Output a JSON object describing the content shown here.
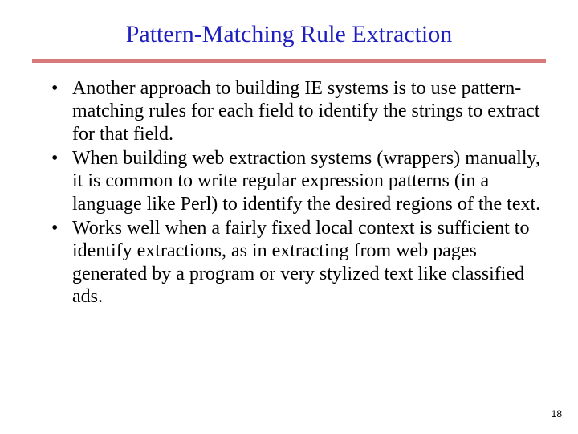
{
  "slide": {
    "title": "Pattern-Matching Rule Extraction",
    "bullets": [
      "Another approach to building IE systems is to use pattern-matching rules for each field to identify the strings to extract for that field.",
      "When building web extraction systems (wrappers) manually, it is common to write regular expression patterns (in a language like Perl) to identify the desired regions of the text.",
      "Works well when a fairly fixed local context is sufficient to identify extractions, as in extracting from web pages generated by a program or very stylized text like classified ads."
    ],
    "page_number": "18"
  }
}
